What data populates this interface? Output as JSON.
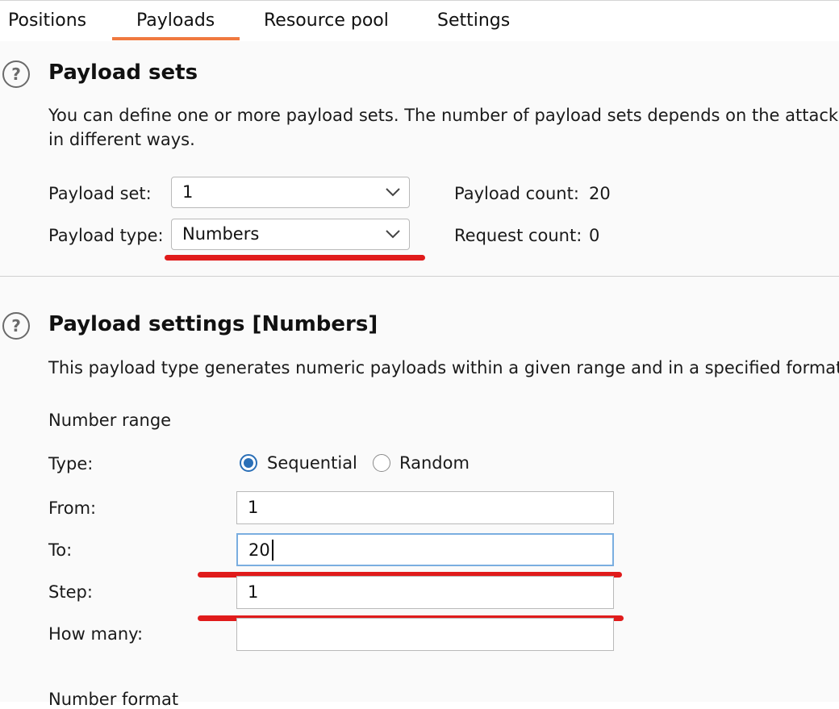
{
  "tabs": [
    {
      "label": "Positions"
    },
    {
      "label": "Payloads",
      "active": true
    },
    {
      "label": "Resource pool"
    },
    {
      "label": "Settings"
    }
  ],
  "payload_sets": {
    "help_icon": "question-circle-icon",
    "heading": "Payload sets",
    "description_line1": "You can define one or more payload sets. The number of payload sets depends on the attack",
    "description_line2": "in different ways.",
    "payload_set_label": "Payload set:",
    "payload_set_value": "1",
    "payload_type_label": "Payload type:",
    "payload_type_value": "Numbers",
    "payload_count_label": "Payload count:",
    "payload_count_value": "20",
    "request_count_label": "Request count:",
    "request_count_value": "0"
  },
  "payload_settings": {
    "help_icon": "question-circle-icon",
    "heading": "Payload settings [Numbers]",
    "description": "This payload type generates numeric payloads within a given range and in a specified format",
    "number_range_label": "Number range",
    "type_label": "Type:",
    "type_options": [
      {
        "label": "Sequential",
        "selected": true
      },
      {
        "label": "Random",
        "selected": false
      }
    ],
    "from_label": "From:",
    "from_value": "1",
    "to_label": "To:",
    "to_value": "20",
    "step_label": "Step:",
    "step_value": "1",
    "how_many_label": "How many:",
    "how_many_value": "",
    "number_format_label": "Number format"
  },
  "colors": {
    "tab_accent": "#f0793f",
    "annotation_red": "#e01b1b",
    "radio_blue": "#2a6fb7",
    "focus_border": "#7aaee0"
  }
}
